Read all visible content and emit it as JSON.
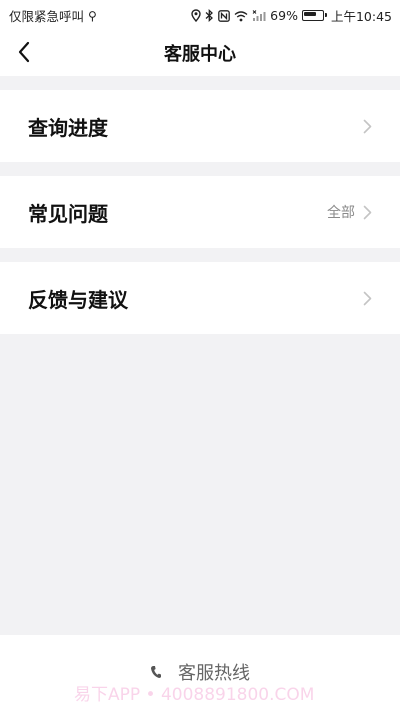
{
  "status_bar": {
    "emergency_text": "仅限紧急呼叫",
    "battery_percent": "69%",
    "time": "上午10:45",
    "icons": [
      "usb-icon",
      "location-icon",
      "bluetooth-icon",
      "nfc-icon",
      "wifi-icon",
      "signal-icon",
      "battery-icon"
    ]
  },
  "nav": {
    "title": "客服中心",
    "back_icon": "chevron-left-icon"
  },
  "menu": {
    "items": [
      {
        "label": "查询进度",
        "extra": ""
      },
      {
        "label": "常见问题",
        "extra": "全部"
      },
      {
        "label": "反馈与建议",
        "extra": ""
      }
    ]
  },
  "footer": {
    "hotline_label": "客服热线",
    "hotline_icon": "phone-icon"
  },
  "watermark": {
    "text": "易下APP • 4008891800.COM"
  },
  "colors": {
    "background": "#f2f2f4",
    "surface": "#ffffff",
    "text_primary": "#111111",
    "text_secondary": "#8a8a8a",
    "chevron": "#c4c4c4"
  }
}
